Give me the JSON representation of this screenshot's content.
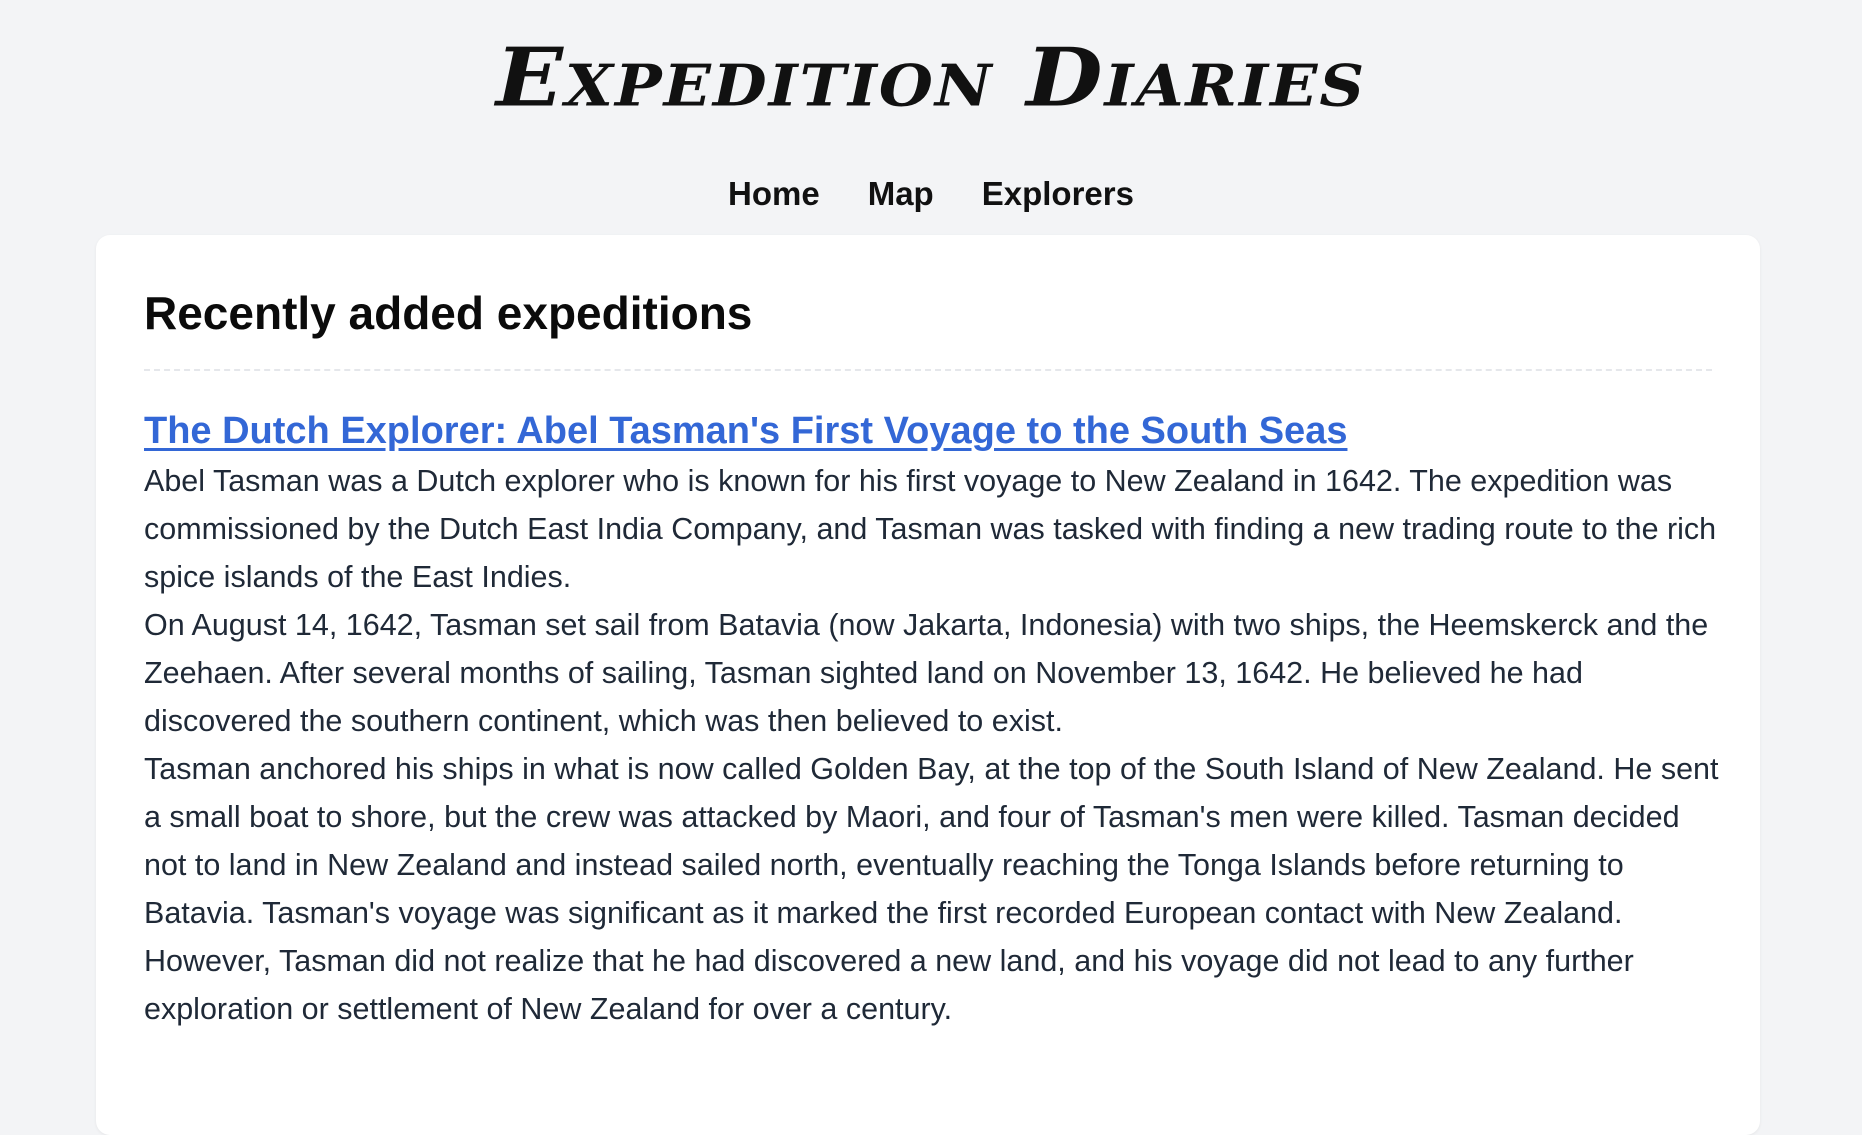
{
  "site": {
    "logo_text": "Expedition Diaries"
  },
  "nav": {
    "items": [
      {
        "label": "Home"
      },
      {
        "label": "Map"
      },
      {
        "label": "Explorers"
      }
    ]
  },
  "main": {
    "section_title": "Recently added expeditions",
    "articles": [
      {
        "title": "The Dutch Explorer: Abel Tasman's First Voyage to the South Seas",
        "paragraphs": [
          "Abel Tasman was a Dutch explorer who is known for his first voyage to New Zealand in 1642. The expedition was commissioned by the Dutch East India Company, and Tasman was tasked with finding a new trading route to the rich spice islands of the East Indies.",
          "On August 14, 1642, Tasman set sail from Batavia (now Jakarta, Indonesia) with two ships, the Heemskerck and the Zeehaen. After several months of sailing, Tasman sighted land on November 13, 1642. He believed he had discovered the southern continent, which was then believed to exist.",
          "Tasman anchored his ships in what is now called Golden Bay, at the top of the South Island of New Zealand. He sent a small boat to shore, but the crew was attacked by Maori, and four of Tasman's men were killed. Tasman decided not to land in New Zealand and instead sailed north, eventually reaching the Tonga Islands before returning to Batavia. Tasman's voyage was significant as it marked the first recorded European contact with New Zealand. However, Tasman did not realize that he had discovered a new land, and his voyage did not lead to any further exploration or settlement of New Zealand for over a century."
        ]
      }
    ]
  },
  "colors": {
    "page_background": "#f3f4f6",
    "card_background": "#ffffff",
    "link": "#3367d6",
    "text": "#1f2937"
  }
}
